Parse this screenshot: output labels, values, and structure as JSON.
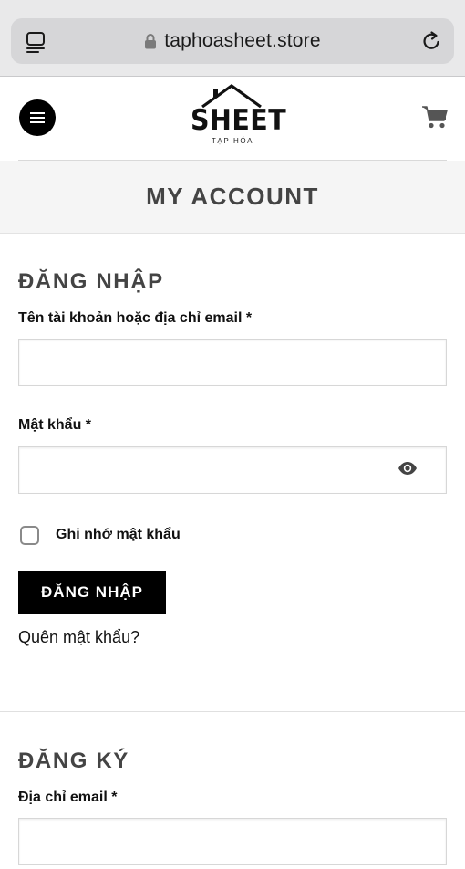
{
  "browser": {
    "url": "taphoasheet.store"
  },
  "header": {
    "logo_word": "SHEET",
    "logo_sub": "TẠP HÓA"
  },
  "page": {
    "title": "MY ACCOUNT"
  },
  "login": {
    "heading": "ĐĂNG NHẬP",
    "username_label": "Tên tài khoản hoặc địa chỉ email *",
    "username_value": "",
    "password_label": "Mật khẩu *",
    "password_value": "",
    "remember_label": "Ghi nhớ mật khẩu",
    "remember_checked": false,
    "submit_label": "ĐĂNG NHẬP",
    "forgot_label": "Quên mật khẩu?"
  },
  "register": {
    "heading": "ĐĂNG KÝ",
    "email_label": "Địa chỉ email *",
    "email_value": ""
  },
  "icons": {
    "tabs": "tabs-icon",
    "lock": "lock-icon",
    "reload": "reload-icon",
    "menu": "hamburger-menu-icon",
    "cart": "cart-icon",
    "show_password": "eye-icon"
  },
  "colors": {
    "accent": "#000000",
    "heading": "#444444",
    "band_bg": "#f5f5f5"
  }
}
